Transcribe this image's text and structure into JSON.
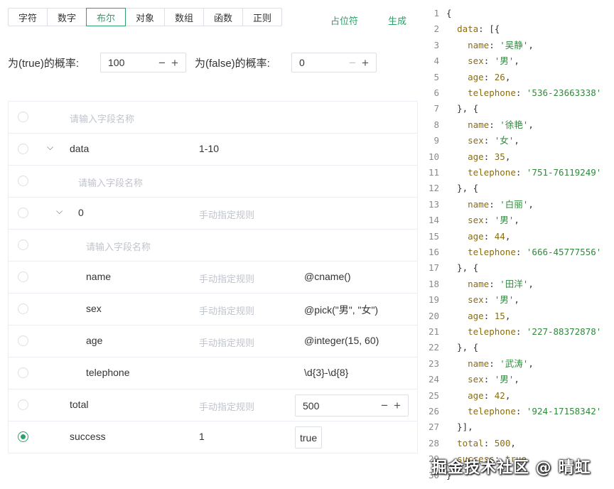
{
  "tabs": [
    "字符",
    "数字",
    "布尔",
    "对象",
    "数组",
    "函数",
    "正则"
  ],
  "active_tab": "布尔",
  "actions": {
    "placeholder_label": "占位符",
    "generate_label": "生成"
  },
  "probability": {
    "true_label": "为(true)的概率:",
    "true_value": "100",
    "false_label": "为(false)的概率:",
    "false_value": "0"
  },
  "fields": {
    "name_placeholder": "请输入字段名称",
    "rule_placeholder": "手动指定规则",
    "rows": {
      "data_name": "data",
      "data_count": "1-10",
      "item_name": "0",
      "name_name": "name",
      "name_expr": "@cname()",
      "sex_name": "sex",
      "sex_expr": "@pick(\"男\", \"女\")",
      "age_name": "age",
      "age_expr": "@integer(15, 60)",
      "telephone_name": "telephone",
      "telephone_expr": "\\d{3}-\\d{8}",
      "total_name": "total",
      "total_value": "500",
      "success_name": "success",
      "success_count": "1",
      "success_value": "true"
    }
  },
  "code_lines": [
    "{",
    "  data: [{",
    "    name: '吴静',",
    "    sex: '男',",
    "    age: 26,",
    "    telephone: '536-23663338'",
    "  }, {",
    "    name: '徐艳',",
    "    sex: '女',",
    "    age: 35,",
    "    telephone: '751-76119249'",
    "  }, {",
    "    name: '白丽',",
    "    sex: '男',",
    "    age: 44,",
    "    telephone: '666-45777556'",
    "  }, {",
    "    name: '田洋',",
    "    sex: '男',",
    "    age: 15,",
    "    telephone: '227-88372878'",
    "  }, {",
    "    name: '武涛',",
    "    sex: '男',",
    "    age: 42,",
    "    telephone: '924-17158342'",
    "  }],",
    "  total: 500,",
    "  success: true",
    "}"
  ],
  "watermark": "掘金技术社区 @ 晴虹",
  "colors": {
    "accent": "#2ea06a",
    "string": "#2f8a3c",
    "keyword": "#8a6d12"
  }
}
